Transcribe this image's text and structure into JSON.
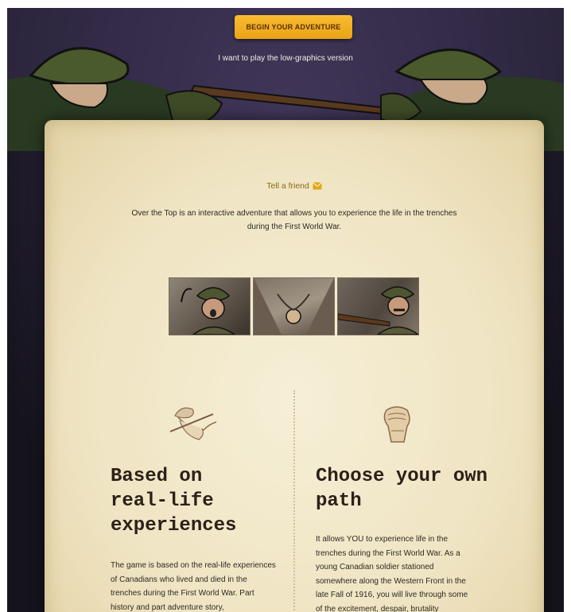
{
  "hero": {
    "cta_label": "BEGIN YOUR ADVENTURE",
    "low_graphics_link": "I want to play the low-graphics version"
  },
  "share": {
    "tell_friend_label": "Tell a friend",
    "icon": "envelope-icon"
  },
  "intro_text": "Over the Top is an interactive adventure that allows you to experience the life in the trenches during the First World War.",
  "comic_panels": [
    "soldier-portrait",
    "trench-scene",
    "soldier-aiming"
  ],
  "features": [
    {
      "icon": "soldier-crawling-icon",
      "title": "Based on real-life experiences",
      "body": "The game is based on the real-life experiences of Canadians who lived and died in the trenches during the First World War. Part history and part adventure story,"
    },
    {
      "icon": "clenched-fist-icon",
      "title": "Choose your own path",
      "body": "It allows YOU to experience life in the trenches during the First World War. As a young Canadian soldier stationed somewhere along the Western Front in the late Fall of 1916, you will live through some of the excitement, despair, brutality"
    }
  ],
  "colors": {
    "accent": "#f2b124",
    "paper": "#f3ead0",
    "link": "#8a6a14",
    "background": "#2c2540"
  }
}
